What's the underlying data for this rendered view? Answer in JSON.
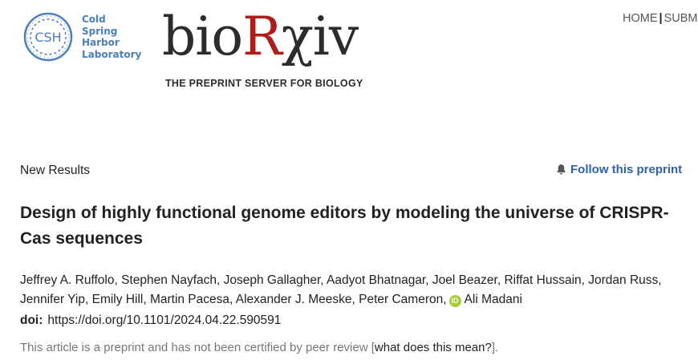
{
  "header": {
    "csh_logo": {
      "abbr": "CSH",
      "lines": [
        "Cold",
        "Spring",
        "Harbor",
        "Laboratory"
      ],
      "color": "#4a7fc1"
    },
    "biorxiv_logo": {
      "part1": "bio",
      "part2": "R",
      "part3": "χiv",
      "tagline": "THE PREPRINT SERVER FOR BIOLOGY",
      "red": "#b31b1b"
    },
    "nav": {
      "home": "HOME",
      "separator": "|",
      "submit": "SUBM"
    }
  },
  "article": {
    "section": "New Results",
    "follow_label": "Follow this preprint",
    "title": "Design of highly functional genome editors by modeling the universe of CRISPR-Cas sequences",
    "authors_line1": "Jeffrey A. Ruffolo, Stephen Nayfach, Joseph Gallagher, Aadyot Bhatnagar, Joel Beazer, Riffat Hussain, Jordan Russ,",
    "authors_line2": "Jennifer Yip, Emily Hill, Martin Pacesa, Alexander J. Meeske, Peter Cameron,",
    "orcid_badge": "iD",
    "last_author": "Ali Madani",
    "doi_label": "doi:",
    "doi_value": "https://doi.org/10.1101/2024.04.22.590591",
    "review_note_prefix": "This article is a preprint and has not been certified by peer review [",
    "review_note_link": "what does this mean?",
    "review_note_suffix": "]."
  }
}
